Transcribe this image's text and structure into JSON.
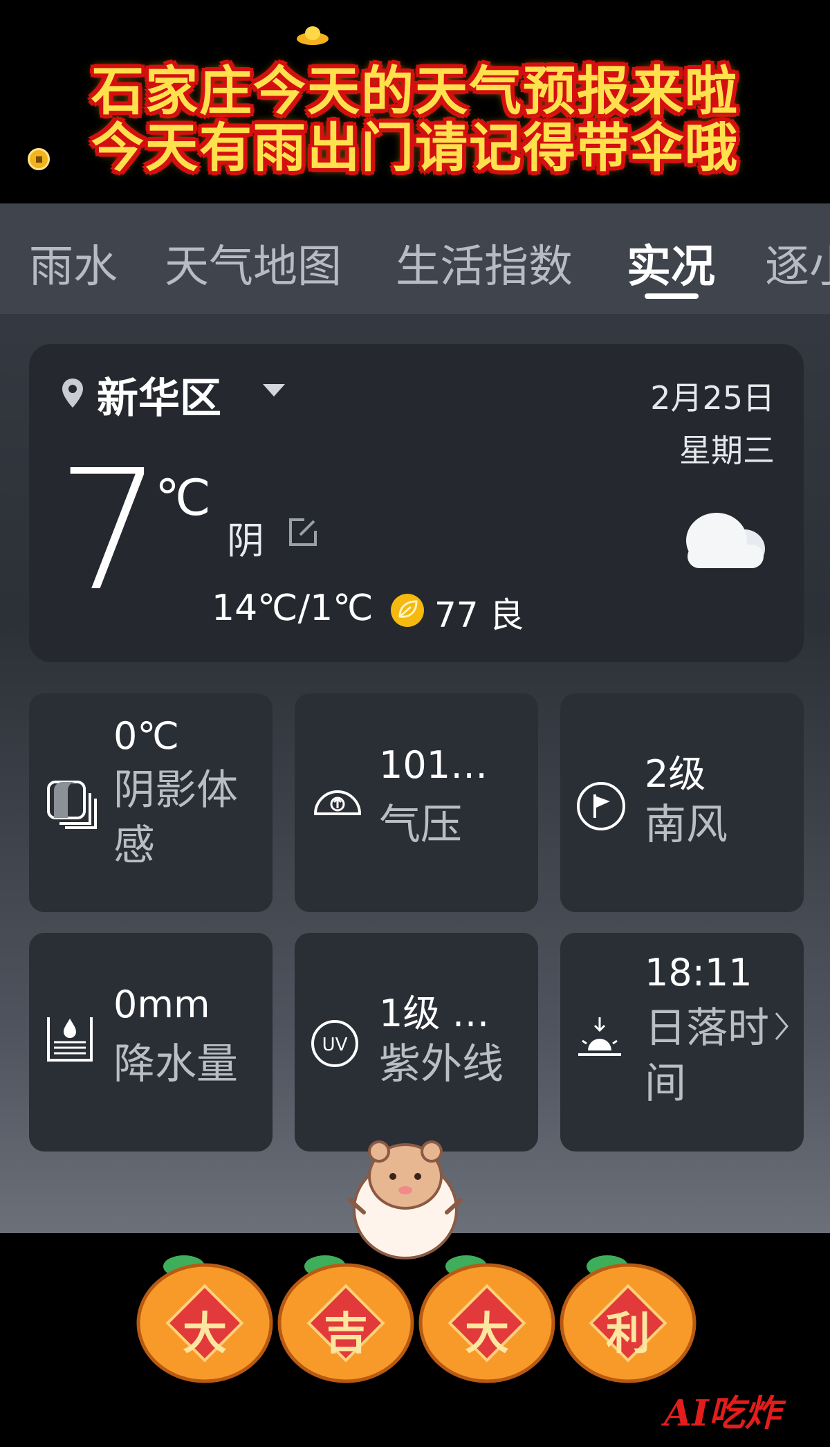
{
  "banner": {
    "line1": "石家庄今天的天气预报来啦",
    "line2": "今天有雨出门请记得带伞哦"
  },
  "tabs": [
    {
      "label": "雨水",
      "active": false
    },
    {
      "label": "天气地图",
      "active": false
    },
    {
      "label": "生活指数",
      "active": false
    },
    {
      "label": "实况",
      "active": true
    },
    {
      "label": "逐小",
      "active": false
    }
  ],
  "current": {
    "location": "新华区",
    "date": "2月25日",
    "weekday": "星期三",
    "temperature": "7",
    "unit": "℃",
    "condition": "阴",
    "range": "14℃/1℃",
    "aqi": "77 良",
    "icons": {
      "location": "location-pin-icon",
      "edit": "edit-icon",
      "weather": "cloud-icon",
      "aqi": "leaf-icon"
    }
  },
  "details": [
    {
      "value": "0℃",
      "label": "阴影体感",
      "icon": "feels-like-icon"
    },
    {
      "value": "101…",
      "label": "气压",
      "icon": "pressure-gauge-icon"
    },
    {
      "value": "2级",
      "label": "南风",
      "icon": "wind-flag-icon"
    },
    {
      "value": "0mm",
      "label": "降水量",
      "icon": "rain-gauge-icon"
    },
    {
      "value": "1级 …",
      "label": "紫外线",
      "icon": "uv-icon"
    },
    {
      "value": "18:11",
      "label": "日落时间",
      "icon": "sunset-icon"
    }
  ],
  "decoration": {
    "oranges": [
      "大",
      "吉",
      "大",
      "利"
    ],
    "watermark": "AI吃炸"
  },
  "colors": {
    "banner_text": "#ffe14d",
    "banner_outline": "#d40f0f",
    "card_bg": "#25292f",
    "aqi_badge": "#f5b90f",
    "orange": "#f79a2a"
  }
}
